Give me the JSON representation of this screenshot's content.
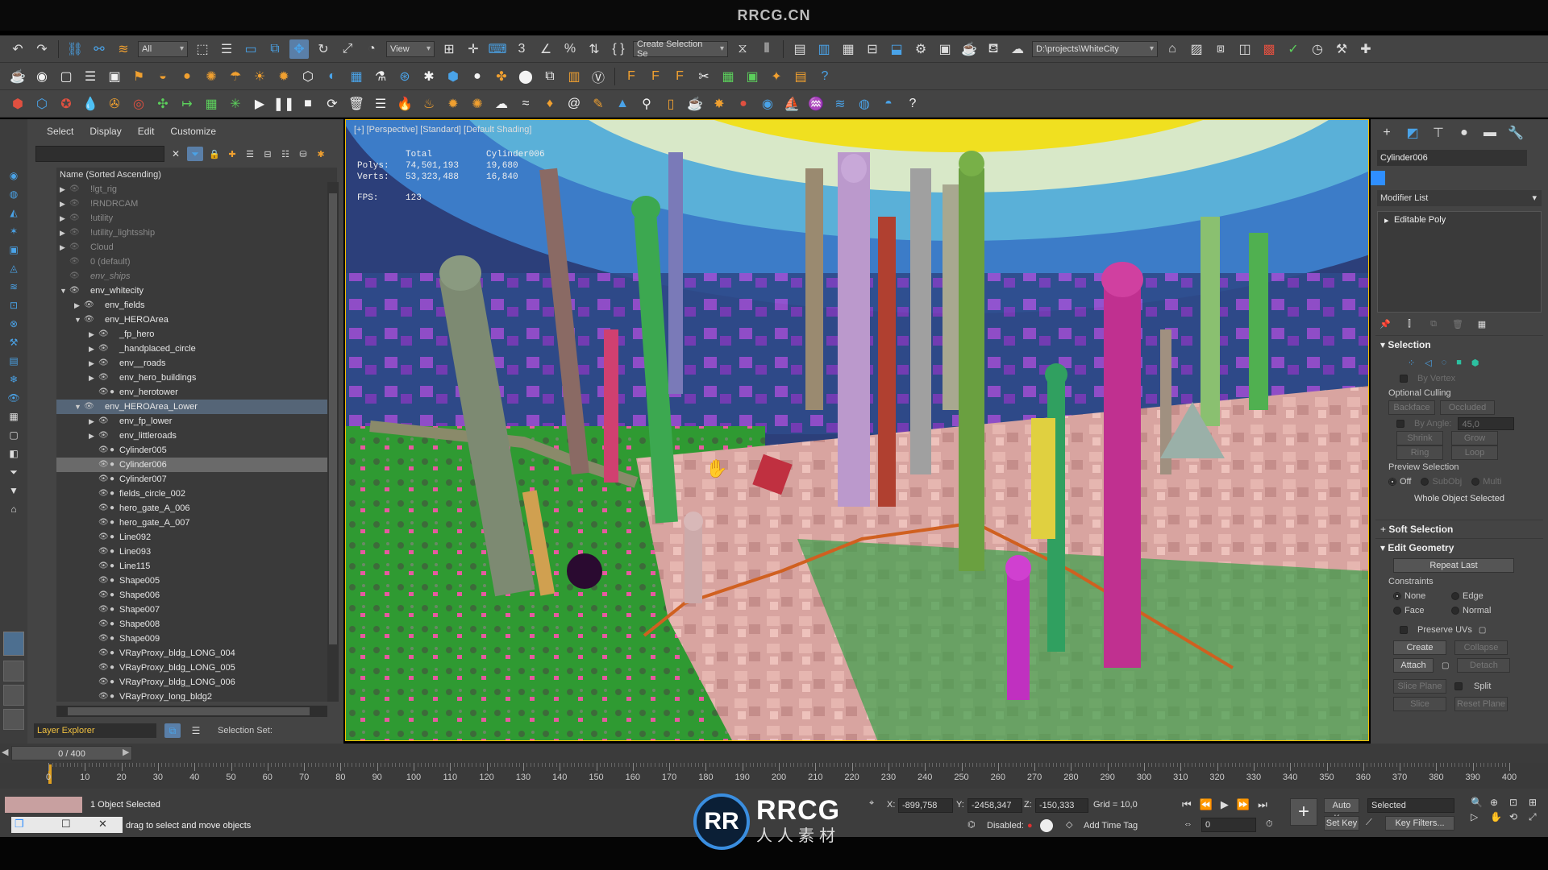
{
  "brand": "RRCG.CN",
  "toolbar": {
    "filter_select": "All",
    "view_select": "View",
    "create_selection_set": "Create Selection Se",
    "project_path": "D:\\projects\\WhiteCity"
  },
  "scene_explorer": {
    "menu": [
      "Select",
      "Display",
      "Edit",
      "Customize"
    ],
    "column_header": "Name (Sorted Ascending)",
    "rows": [
      {
        "label": "!lgt_rig",
        "depth": 0,
        "expander": "right",
        "dim": true
      },
      {
        "label": "!RNDRCAM",
        "depth": 0,
        "expander": "right",
        "dim": true
      },
      {
        "label": "!utility",
        "depth": 0,
        "expander": "right",
        "dim": true
      },
      {
        "label": "!utility_lightsship",
        "depth": 0,
        "expander": "right",
        "dim": true
      },
      {
        "label": "Cloud",
        "depth": 0,
        "expander": "right",
        "dim": true
      },
      {
        "label": "0 (default)",
        "depth": 0,
        "expander": "",
        "dim": true
      },
      {
        "label": "env_ships",
        "depth": 0,
        "expander": "",
        "dim": true
      },
      {
        "label": "env_whitecity",
        "depth": 0,
        "expander": "down",
        "dim": false
      },
      {
        "label": "env_fields",
        "depth": 1,
        "expander": "right",
        "dim": false
      },
      {
        "label": "env_HEROArea",
        "depth": 1,
        "expander": "down",
        "dim": false
      },
      {
        "label": "_fp_hero",
        "depth": 2,
        "expander": "right",
        "dim": false
      },
      {
        "label": "_handplaced_circle",
        "depth": 2,
        "expander": "right",
        "dim": false
      },
      {
        "label": "env__roads",
        "depth": 2,
        "expander": "right",
        "dim": false
      },
      {
        "label": "env_hero_buildings",
        "depth": 2,
        "expander": "right",
        "dim": false
      },
      {
        "label": "env_herotower",
        "depth": 2,
        "expander": "",
        "dim": false
      },
      {
        "label": "env_HEROArea_Lower",
        "depth": 1,
        "expander": "down",
        "dim": false,
        "selected": true
      },
      {
        "label": "env_fp_lower",
        "depth": 2,
        "expander": "right",
        "dim": false
      },
      {
        "label": "env_littleroads",
        "depth": 2,
        "expander": "right",
        "dim": false
      },
      {
        "label": "Cylinder005",
        "depth": 2,
        "expander": "",
        "dim": false
      },
      {
        "label": "Cylinder006",
        "depth": 2,
        "expander": "",
        "dim": false,
        "object_selected": true
      },
      {
        "label": "Cylinder007",
        "depth": 2,
        "expander": "",
        "dim": false
      },
      {
        "label": "fields_circle_002",
        "depth": 2,
        "expander": "",
        "dim": false
      },
      {
        "label": "hero_gate_A_006",
        "depth": 2,
        "expander": "",
        "dim": false
      },
      {
        "label": "hero_gate_A_007",
        "depth": 2,
        "expander": "",
        "dim": false
      },
      {
        "label": "Line092",
        "depth": 2,
        "expander": "",
        "dim": false
      },
      {
        "label": "Line093",
        "depth": 2,
        "expander": "",
        "dim": false
      },
      {
        "label": "Line115",
        "depth": 2,
        "expander": "",
        "dim": false
      },
      {
        "label": "Shape005",
        "depth": 2,
        "expander": "",
        "dim": false
      },
      {
        "label": "Shape006",
        "depth": 2,
        "expander": "",
        "dim": false
      },
      {
        "label": "Shape007",
        "depth": 2,
        "expander": "",
        "dim": false
      },
      {
        "label": "Shape008",
        "depth": 2,
        "expander": "",
        "dim": false
      },
      {
        "label": "Shape009",
        "depth": 2,
        "expander": "",
        "dim": false
      },
      {
        "label": "VRayProxy_bldg_LONG_004",
        "depth": 2,
        "expander": "",
        "dim": false
      },
      {
        "label": "VRayProxy_bldg_LONG_005",
        "depth": 2,
        "expander": "",
        "dim": false
      },
      {
        "label": "VRayProxy_bldg_LONG_006",
        "depth": 2,
        "expander": "",
        "dim": false
      },
      {
        "label": "VRayProxy_long_bldg2",
        "depth": 2,
        "expander": "",
        "dim": false
      }
    ],
    "footer_layer": "Layer Explorer",
    "footer_selection_set": "Selection Set:"
  },
  "viewport": {
    "label": "[+] [Perspective] [Standard] [Default Shading]",
    "stats_header": [
      "Total",
      "Cylinder006"
    ],
    "stats_polys": [
      "Polys:",
      "74,501,193",
      "19,680"
    ],
    "stats_verts": [
      "Verts:",
      "53,323,488",
      "16,840"
    ],
    "fps_label": "FPS:",
    "fps_value": "123"
  },
  "command_panel": {
    "object_name": "Cylinder006",
    "object_color": "#2f8fff",
    "modifier_list": "Modifier List",
    "stack_item": "Editable Poly",
    "selection": {
      "title": "Selection",
      "by_vertex": "By Vertex",
      "optional_culling": "Optional Culling",
      "backface": "Backface",
      "occluded": "Occluded",
      "by_angle": "By Angle:",
      "by_angle_value": "45,0",
      "shrink": "Shrink",
      "grow": "Grow",
      "ring": "Ring",
      "loop": "Loop",
      "preview_selection": "Preview Selection",
      "preview_off": "Off",
      "preview_subobj": "SubObj",
      "preview_multi": "Multi",
      "whole_object": "Whole Object Selected"
    },
    "soft_selection": "Soft Selection",
    "edit_geometry": {
      "title": "Edit Geometry",
      "repeat_last": "Repeat Last",
      "constraints": "Constraints",
      "none": "None",
      "edge": "Edge",
      "face": "Face",
      "normal": "Normal",
      "preserve_uvs": "Preserve UVs",
      "create": "Create",
      "collapse": "Collapse",
      "attach": "Attach",
      "detach": "Detach",
      "slice_plane": "Slice Plane",
      "split": "Split",
      "slice": "Slice",
      "reset_plane": "Reset Plane"
    }
  },
  "timeline": {
    "frame_display": "0 / 400",
    "ticks": [
      "0",
      "10",
      "20",
      "30",
      "40",
      "50",
      "60",
      "70",
      "80",
      "90",
      "100",
      "110",
      "120",
      "130",
      "140",
      "150",
      "160",
      "170",
      "180",
      "190",
      "200",
      "210",
      "220",
      "230",
      "240",
      "250",
      "260",
      "270",
      "280",
      "290",
      "300",
      "310",
      "320",
      "330",
      "340",
      "350",
      "360",
      "370",
      "380",
      "390",
      "400"
    ]
  },
  "status": {
    "selection_count": "1 Object Selected",
    "prompt": "drag to select and move objects",
    "x_label": "X:",
    "x_value": "-899,758",
    "y_label": "Y:",
    "y_value": "-2458,347",
    "z_label": "Z:",
    "z_value": "-150,333",
    "grid": "Grid = 10,0",
    "disabled_label": "Disabled:",
    "add_time_tag": "Add Time Tag",
    "auto_key": "Auto Key",
    "set_key": "Set Key",
    "key_mode": "Selected",
    "key_filters": "Key Filters...",
    "frame_field": "0"
  },
  "watermark": {
    "logo_letters": "RR",
    "title": "RRCG",
    "subtitle": "人人素材"
  }
}
